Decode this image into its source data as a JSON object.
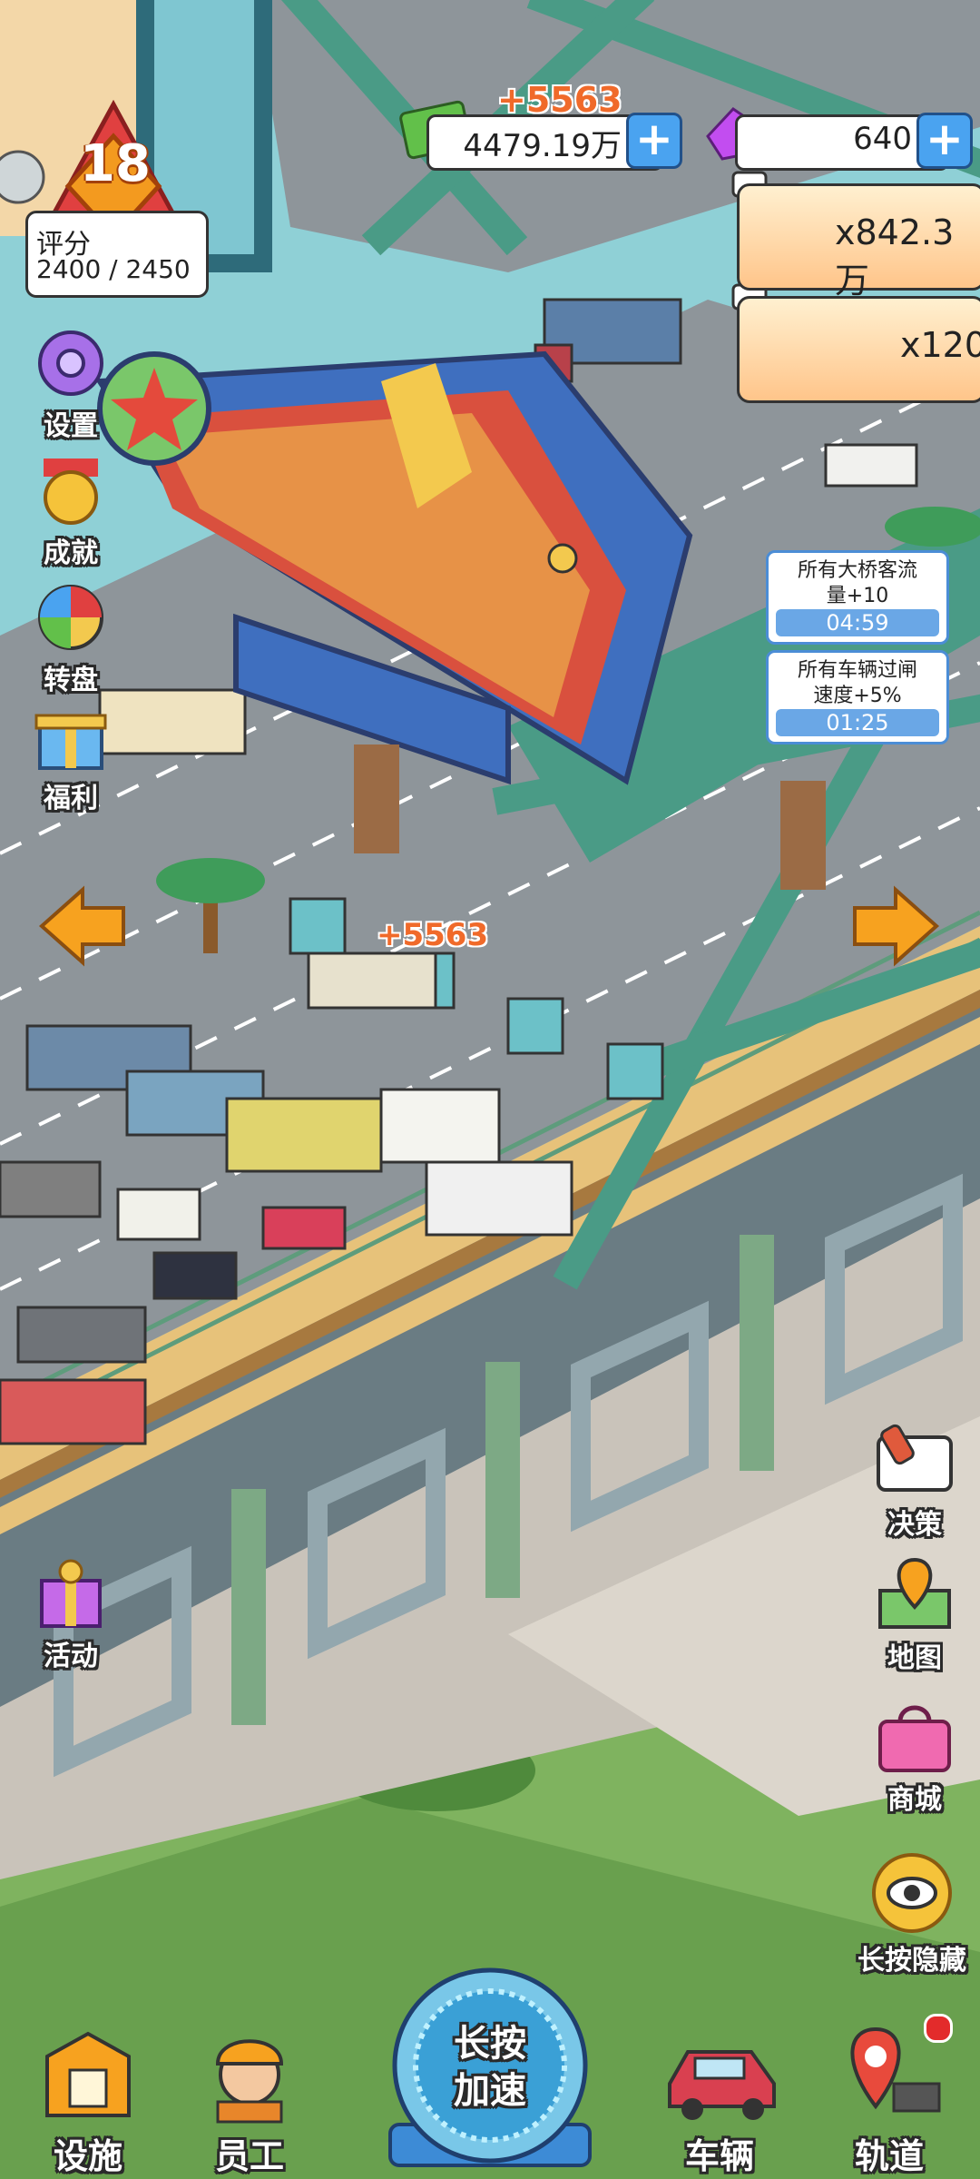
{
  "hud": {
    "level": "18",
    "rating_label": "评分",
    "rating_value": "2400 / 2450",
    "money": "4479.19万",
    "money_gain": "+5563",
    "gems": "640"
  },
  "rewards": {
    "money": "x842.3万",
    "gems": "x120"
  },
  "buffs": [
    {
      "line1": "所有大桥客流",
      "line2": "量+10",
      "time": "04:59"
    },
    {
      "line1": "所有车辆过闸",
      "line2": "速度+5%",
      "time": "01:25"
    }
  ],
  "left_menu": {
    "settings": "设置",
    "achievements": "成就",
    "wheel": "转盘",
    "welfare": "福利",
    "events": "活动"
  },
  "right_menu": {
    "decision": "决策",
    "map": "地图",
    "shop": "商城",
    "hide": "长按隐藏"
  },
  "toll_gain": "+5563",
  "bottom_nav": {
    "facilities": "设施",
    "staff": "员工",
    "boost_line1": "长按",
    "boost_line2": "加速",
    "vehicles": "车辆",
    "track": "轨道"
  },
  "colors": {
    "water": "#8fd0d6",
    "road": "#8e959a",
    "girder": "#4a9b86",
    "sign_blue": "#3f6fbf",
    "grass": "#7fb35f",
    "accent_orange": "#f7a21f"
  }
}
